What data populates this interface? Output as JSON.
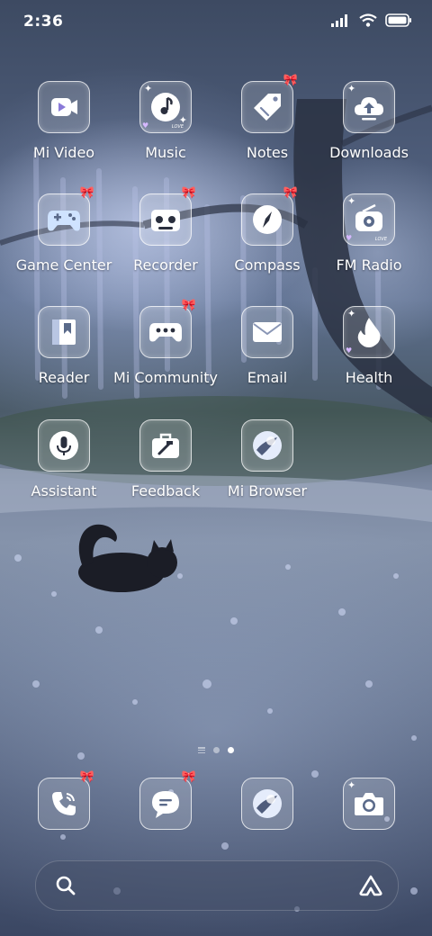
{
  "status_bar": {
    "time": "2:36",
    "icons": [
      "signal-icon",
      "wifi-icon",
      "battery-icon"
    ]
  },
  "home": {
    "apps": [
      {
        "label": "Mi Video",
        "icon": "video-icon"
      },
      {
        "label": "Music",
        "icon": "music-note-icon"
      },
      {
        "label": "Notes",
        "icon": "tag-icon"
      },
      {
        "label": "Downloads",
        "icon": "cloud-upload-icon"
      },
      {
        "label": "Game Center",
        "icon": "gamepad-icon"
      },
      {
        "label": "Recorder",
        "icon": "cassette-icon"
      },
      {
        "label": "Compass",
        "icon": "compass-icon"
      },
      {
        "label": "FM Radio",
        "icon": "radio-icon"
      },
      {
        "label": "Reader",
        "icon": "book-icon"
      },
      {
        "label": "Mi Community",
        "icon": "controller-icon"
      },
      {
        "label": "Email",
        "icon": "envelope-icon"
      },
      {
        "label": "Health",
        "icon": "flame-icon"
      },
      {
        "label": "Assistant",
        "icon": "microphone-icon"
      },
      {
        "label": "Feedback",
        "icon": "toolbox-icon"
      },
      {
        "label": "Mi Browser",
        "icon": "globe-icon"
      }
    ],
    "sticker_text": "LOVE",
    "pages": {
      "total": 2,
      "current": 2
    }
  },
  "dock": [
    {
      "icon": "phone-icon"
    },
    {
      "icon": "message-icon"
    },
    {
      "icon": "browser-icon"
    },
    {
      "icon": "camera-icon"
    }
  ],
  "search_bar": {
    "left_icon": "search-icon",
    "right_icon": "assistant-logo-icon"
  },
  "colors": {
    "tile_border": "#ffffff",
    "accent_purple": "#d6b8ff",
    "glyph": "#5a6a8a"
  }
}
